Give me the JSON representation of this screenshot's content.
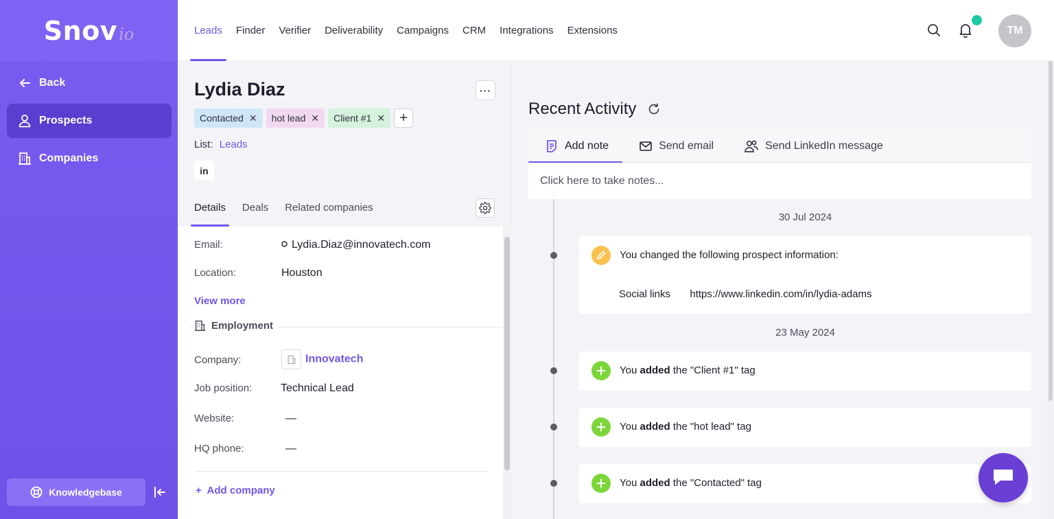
{
  "sidebar": {
    "logo_main": "Snov",
    "logo_sub": "io",
    "back": "Back",
    "items": [
      {
        "label": "Prospects",
        "icon": "user-icon",
        "active": true
      },
      {
        "label": "Companies",
        "icon": "building-icon",
        "active": false
      }
    ],
    "knowledgebase": "Knowledgebase"
  },
  "nav": {
    "items": [
      "Leads",
      "Finder",
      "Verifier",
      "Deliverability",
      "Campaigns",
      "CRM",
      "Integrations",
      "Extensions"
    ],
    "active": "Leads",
    "avatar_initials": "TM"
  },
  "prospect": {
    "name": "Lydia Diaz",
    "more_label": "···",
    "tags": [
      {
        "label": "Contacted",
        "color": "#cfe6f7"
      },
      {
        "label": "hot lead",
        "color": "#f1d9f2"
      },
      {
        "label": "Client #1",
        "color": "#d5f2dc"
      }
    ],
    "tag_add": "+",
    "list_label": "List:",
    "list_value": "Leads",
    "linkedin_label": "in",
    "tabs": [
      "Details",
      "Deals",
      "Related companies"
    ],
    "active_tab": "Details"
  },
  "details": {
    "email_label": "Email:",
    "email_value": "Lydia.Diaz@innovatech.com",
    "location_label": "Location:",
    "location_value": "Houston",
    "view_more": "View more",
    "employment_label": "Employment",
    "company_label": "Company:",
    "company_value": "Innovatech",
    "job_label": "Job position:",
    "job_value": "Technical Lead",
    "website_label": "Website:",
    "website_value": "—",
    "hq_label": "HQ phone:",
    "hq_value": "—",
    "add_company": "Add company"
  },
  "activity": {
    "title": "Recent Activity",
    "tabs": [
      {
        "label": "Add note",
        "icon": "note-icon",
        "active": true
      },
      {
        "label": "Send email",
        "icon": "mail-icon",
        "active": false
      },
      {
        "label": "Send LinkedIn message",
        "icon": "users-icon",
        "active": false
      }
    ],
    "note_placeholder": "Click here to take notes...",
    "date1": "30 Jul 2024",
    "change_text": "You changed the following prospect information:",
    "change_field": "Social links",
    "change_value": "https://www.linkedin.com/in/lydia-adams",
    "date2": "23 May 2024",
    "events": [
      {
        "pre": "You ",
        "verb": "added",
        "post": " the \"Client #1\" tag"
      },
      {
        "pre": "You ",
        "verb": "added",
        "post": " the \"hot lead\" tag"
      },
      {
        "pre": "You ",
        "verb": "added",
        "post": " the \"Contacted\" tag"
      }
    ]
  },
  "colors": {
    "accent": "#7155eb",
    "sidebar": "#7a5cf0",
    "green": "#7cd63a",
    "pencil": "#f9c24d",
    "notification": "#1ec8a5",
    "chat": "#6a3fd4"
  }
}
